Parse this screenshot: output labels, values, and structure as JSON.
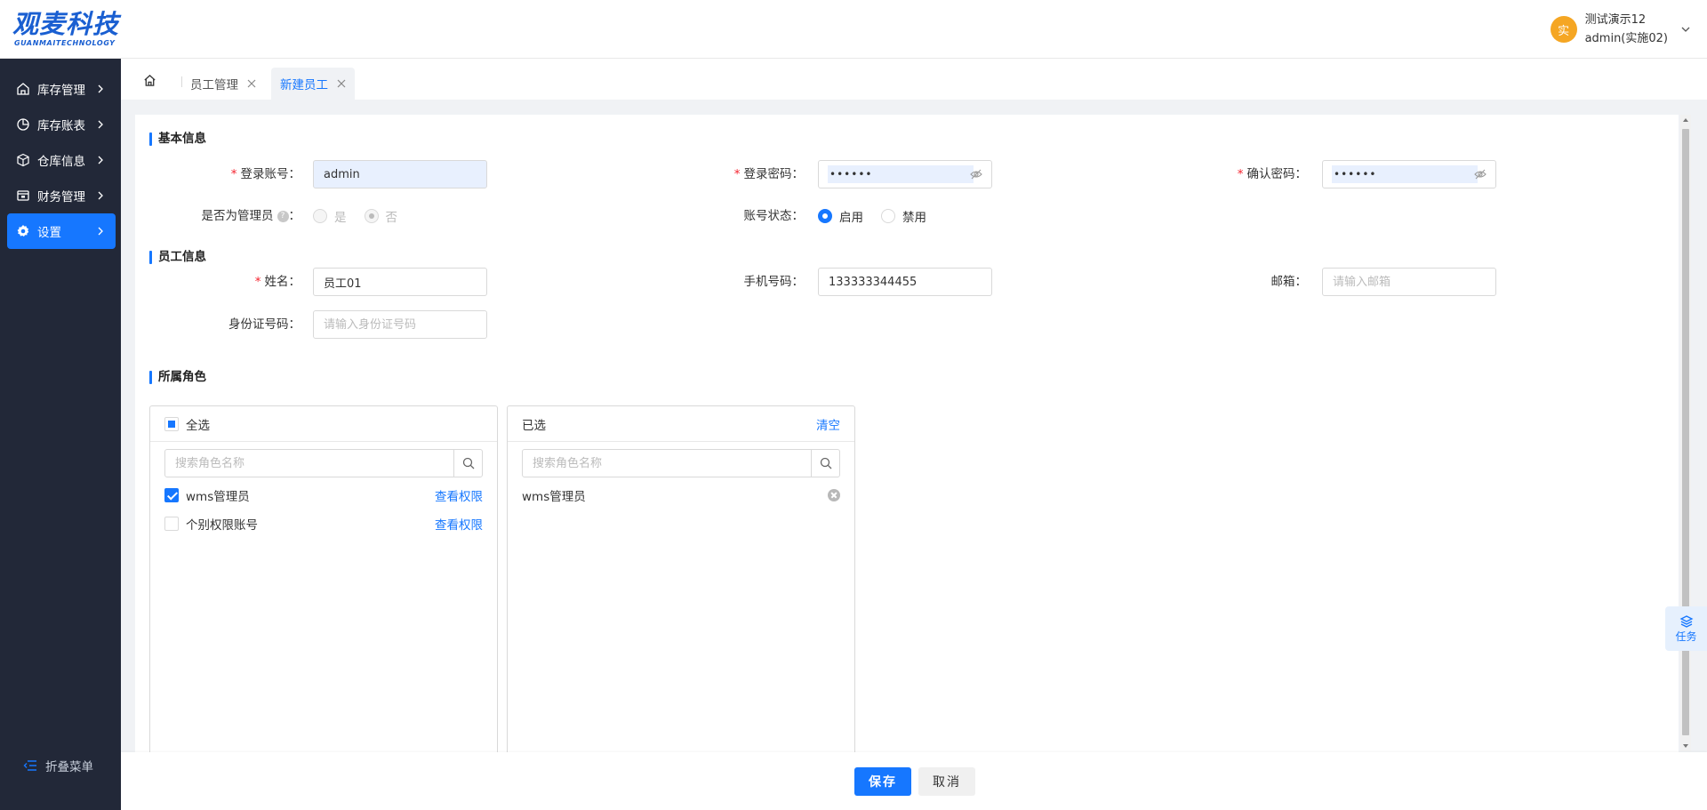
{
  "header": {
    "logo_main": "观麦科技",
    "logo_sub": "GUANMAITECHNOLOGY",
    "avatar_text": "实",
    "user_line1": "测试演示12",
    "user_line2": "admin(实施02)"
  },
  "sidebar": {
    "items": [
      {
        "label": "库存管理",
        "icon": "home-icon"
      },
      {
        "label": "库存账表",
        "icon": "pie-chart-icon"
      },
      {
        "label": "仓库信息",
        "icon": "box-icon"
      },
      {
        "label": "财务管理",
        "icon": "wallet-icon"
      },
      {
        "label": "设置",
        "icon": "gear-icon"
      }
    ],
    "active_index": 4,
    "collapse_label": "折叠菜单"
  },
  "tabs": [
    {
      "label": "员工管理",
      "active": false
    },
    {
      "label": "新建员工",
      "active": true
    }
  ],
  "form": {
    "basic_title": "基本信息",
    "account_label": "登录账号",
    "account_value": "admin",
    "password_label": "登录密码",
    "password_value": "••••••",
    "confirm_label": "确认密码",
    "confirm_value": "••••••",
    "is_admin_label": "是否为管理员",
    "is_admin_yes": "是",
    "is_admin_no": "否",
    "status_label": "账号状态",
    "status_enable": "启用",
    "status_disable": "禁用",
    "employee_title": "员工信息",
    "name_label": "姓名",
    "name_value": "员工01",
    "phone_label": "手机号码",
    "phone_value": "133333344455",
    "email_label": "邮箱",
    "email_placeholder": "请输入邮箱",
    "idcard_label": "身份证号码",
    "idcard_placeholder": "请输入身份证号码",
    "role_title": "所属角色"
  },
  "transfer": {
    "left": {
      "select_all": "全选",
      "search_placeholder": "搜索角色名称",
      "items": [
        {
          "label": "wms管理员",
          "checked": true,
          "link": "查看权限"
        },
        {
          "label": "个别权限账号",
          "checked": false,
          "link": "查看权限"
        }
      ]
    },
    "right": {
      "title": "已选",
      "clear": "清空",
      "search_placeholder": "搜索角色名称",
      "items": [
        {
          "label": "wms管理员"
        }
      ]
    }
  },
  "task_float": {
    "label": "任务"
  },
  "footer": {
    "save": "保存",
    "cancel": "取消"
  }
}
